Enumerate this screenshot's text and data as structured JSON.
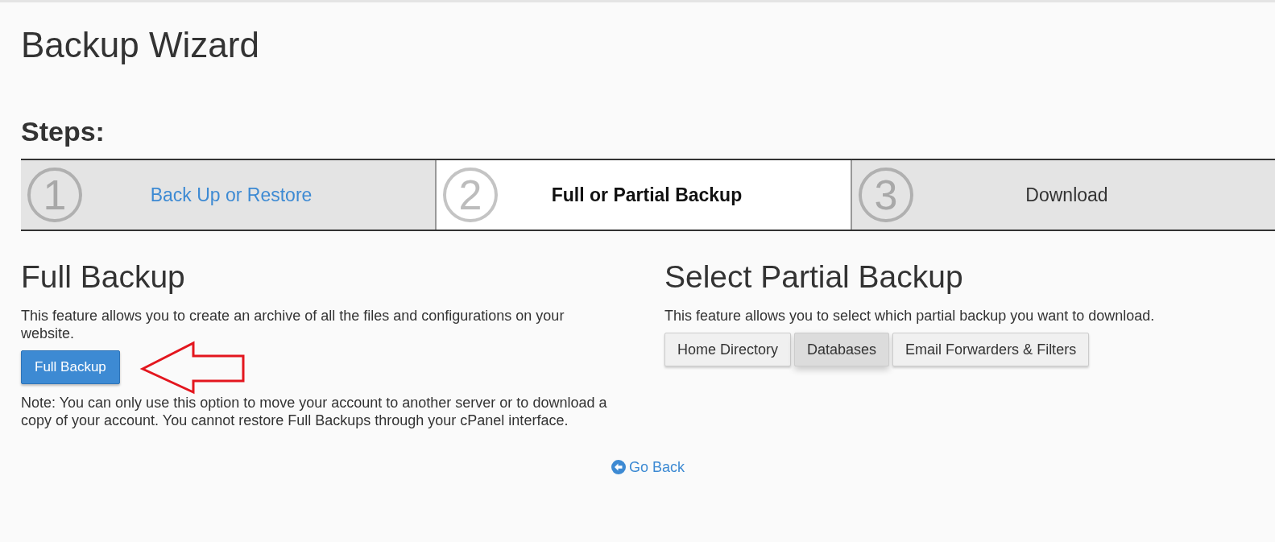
{
  "page": {
    "title": "Backup Wizard"
  },
  "steps": {
    "heading": "Steps:",
    "items": [
      {
        "number": "1",
        "label": "Back Up or Restore",
        "completed": true,
        "current": false
      },
      {
        "number": "2",
        "label": "Full or Partial Backup",
        "completed": false,
        "current": true
      },
      {
        "number": "3",
        "label": "Download",
        "completed": false,
        "current": false
      }
    ]
  },
  "full_backup": {
    "heading": "Full Backup",
    "description": "This feature allows you to create an archive of all the files and configurations on your website.",
    "button": "Full Backup",
    "note": "Note: You can only use this option to move your account to another server or to download a copy of your account. You cannot restore Full Backups through your cPanel interface."
  },
  "partial_backup": {
    "heading": "Select Partial Backup",
    "description": "This feature allows you to select which partial backup you want to download.",
    "buttons": [
      {
        "label": "Home Directory",
        "hovered": false
      },
      {
        "label": "Databases",
        "hovered": true
      },
      {
        "label": "Email Forwarders & Filters",
        "hovered": false
      }
    ]
  },
  "go_back": {
    "label": "Go Back"
  }
}
